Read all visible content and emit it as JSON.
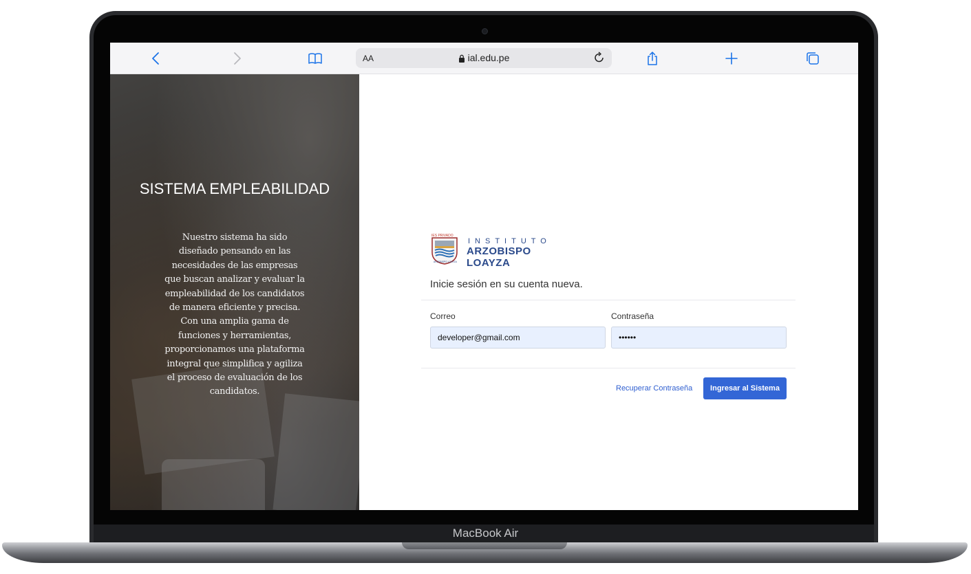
{
  "device": {
    "label": "MacBook Air"
  },
  "browser": {
    "text_size_label": "AA",
    "url": "ial.edu.pe",
    "icons": {
      "back": "chevron-left-icon",
      "forward": "chevron-right-icon",
      "bookmarks": "book-icon",
      "lock": "lock-icon",
      "reload": "reload-icon",
      "share": "share-icon",
      "new_tab": "plus-icon",
      "tabs": "tabs-icon"
    },
    "accent_color": "#1a73e8"
  },
  "hero": {
    "title": "SISTEMA EMPLEABILIDAD",
    "description": "Nuestro sistema ha sido diseñado pensando en las necesidades de las empresas que buscan analizar y evaluar la empleabilidad de los candidatos de manera eficiente y precisa. Con una amplia gama de funciones y herramientas, proporcionamos una plataforma integral que simplifica y agiliza el proceso de evaluación de los candidatos."
  },
  "logo": {
    "seal_top_text": "IES PRIVADO",
    "seal_bottom_text": "ARZOBISPO LOAYZA",
    "line1": "INSTITUTO",
    "line2": "ARZOBISPO LOAYZA",
    "color": "#2b4a8b"
  },
  "login": {
    "subtitle": "Inicie sesión en su cuenta nueva.",
    "email_label": "Correo",
    "email_value": "developer@gmail.com",
    "password_label": "Contraseña",
    "password_value": "••••••",
    "recover_link": "Recuperar Contraseña",
    "submit_button": "Ingresar al Sistema",
    "button_color": "#3366d6"
  }
}
